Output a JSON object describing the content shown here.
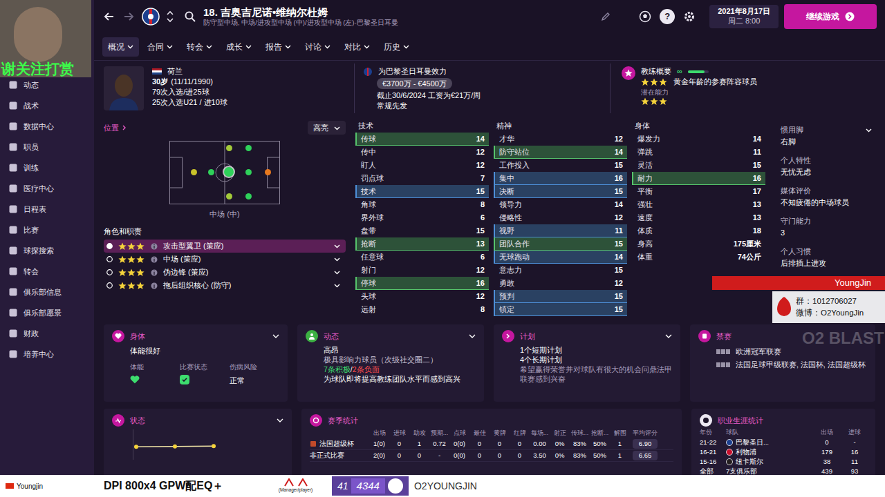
{
  "overlay": {
    "webcam_caption": "谢关注打赏",
    "banner_name": "YoungJin",
    "group": "群：1012706027",
    "weibo": "微博：O2YoungJin",
    "logo": "O2 BLAST",
    "bottom_name": "Youngjin",
    "bottom_text": "DPI 800x4 GPW配EQ＋",
    "sponsor": "(Manager/player)",
    "badge_num1": "41",
    "badge_num2": "4344",
    "channel": "O2YOUNGJIN"
  },
  "header": {
    "title": "18. 吉奥吉尼诺•维纳尔杜姆",
    "subtitle": "防守型中场, 中场/进攻型中场 (中)/进攻型中场 (左)-巴黎圣日耳曼",
    "help": "?",
    "date": "2021年8月17日",
    "time": "周二 8:00",
    "continue": "继续游戏"
  },
  "menu": [
    {
      "label": "概况",
      "selected": true
    },
    {
      "label": "合同",
      "selected": false
    },
    {
      "label": "转会",
      "selected": false
    },
    {
      "label": "成长",
      "selected": false
    },
    {
      "label": "报告",
      "selected": false
    },
    {
      "label": "讨论",
      "selected": false
    },
    {
      "label": "对比",
      "selected": false
    },
    {
      "label": "历史",
      "selected": false
    }
  ],
  "sidebar": [
    {
      "label": "动态"
    },
    {
      "label": "战术"
    },
    {
      "label": "数据中心"
    },
    {
      "label": "职员"
    },
    {
      "label": "训练"
    },
    {
      "label": "医疗中心"
    },
    {
      "label": "日程表"
    },
    {
      "label": "比赛"
    },
    {
      "label": "球探搜索"
    },
    {
      "label": "转会"
    },
    {
      "label": "俱乐部信息"
    },
    {
      "label": "俱乐部愿景"
    },
    {
      "label": "财政"
    },
    {
      "label": "培养中心"
    }
  ],
  "player": {
    "nationality": "荷兰",
    "age": "30岁",
    "birth": "(11/11/1990)",
    "caps": "79次入选/进25球",
    "u21_caps": "25次入选U21 / 进10球"
  },
  "club": {
    "plays_for": "为巴黎圣日耳曼效力",
    "value": "€3700万 - €4500万",
    "contract": "截止30/6/2024 工资为€21万/周",
    "status": "常规先发"
  },
  "coach": {
    "title": "教练概要",
    "infinity": "∞",
    "level": 0.8,
    "stars": 3,
    "summary": "黄金年龄的参赛阵容球员",
    "potential_label": "潜在能力",
    "potential_stars": 3
  },
  "position": {
    "title": "位置",
    "dropdown": "高亮",
    "label": "中场 (中)",
    "roles_title": "角色和职责",
    "dots": [
      {
        "color": "#a3c93a",
        "selected": false
      },
      {
        "color": "#2fd15a",
        "selected": false
      },
      {
        "color": "#c9c22a",
        "selected": false
      },
      {
        "color": "#2fd15a",
        "selected": false
      },
      {
        "color": "#2fd15a",
        "selected": true
      },
      {
        "color": "#2fd15a",
        "selected": false
      },
      {
        "color": "#e8781e",
        "selected": false
      },
      {
        "color": "#a3c93a",
        "selected": false
      },
      {
        "color": "#2fd15a",
        "selected": false
      }
    ],
    "roles": [
      {
        "name": "攻击型翼卫 (策应)",
        "stars": 3,
        "selected": true
      },
      {
        "name": "中场 (策应)",
        "stars": 3,
        "selected": false
      },
      {
        "name": "伪边锋 (策应)",
        "stars": 3,
        "selected": false
      },
      {
        "name": "拖后组织核心 (防守)",
        "stars": 3,
        "selected": false
      }
    ]
  },
  "attributes": [
    {
      "title": "技术",
      "rows": [
        {
          "name": "传球",
          "value": "14",
          "highlight": "green"
        },
        {
          "name": "传中",
          "value": "12",
          "highlight": "none"
        },
        {
          "name": "盯人",
          "value": "12",
          "highlight": "none"
        },
        {
          "name": "罚点球",
          "value": "7",
          "highlight": "none"
        },
        {
          "name": "技术",
          "value": "15",
          "highlight": "blue"
        },
        {
          "name": "角球",
          "value": "8",
          "highlight": "none"
        },
        {
          "name": "界外球",
          "value": "6",
          "highlight": "none"
        },
        {
          "name": "盘带",
          "value": "15",
          "highlight": "none"
        },
        {
          "name": "抢断",
          "value": "13",
          "highlight": "green"
        },
        {
          "name": "任意球",
          "value": "6",
          "highlight": "none"
        },
        {
          "name": "射门",
          "value": "12",
          "highlight": "none"
        },
        {
          "name": "停球",
          "value": "16",
          "highlight": "green"
        },
        {
          "name": "头球",
          "value": "12",
          "highlight": "none"
        },
        {
          "name": "远射",
          "value": "8",
          "highlight": "none"
        }
      ]
    },
    {
      "title": "精神",
      "rows": [
        {
          "name": "才华",
          "value": "12",
          "highlight": "none"
        },
        {
          "name": "防守站位",
          "value": "14",
          "highlight": "green"
        },
        {
          "name": "工作投入",
          "value": "15",
          "highlight": "none"
        },
        {
          "name": "集中",
          "value": "16",
          "highlight": "blue"
        },
        {
          "name": "决断",
          "value": "15",
          "highlight": "blue"
        },
        {
          "name": "领导力",
          "value": "14",
          "highlight": "none"
        },
        {
          "name": "侵略性",
          "value": "12",
          "highlight": "none"
        },
        {
          "name": "视野",
          "value": "11",
          "highlight": "blue"
        },
        {
          "name": "团队合作",
          "value": "15",
          "highlight": "green"
        },
        {
          "name": "无球跑动",
          "value": "14",
          "highlight": "blue"
        },
        {
          "name": "意志力",
          "value": "15",
          "highlight": "none"
        },
        {
          "name": "勇敢",
          "value": "12",
          "highlight": "none"
        },
        {
          "name": "预判",
          "value": "15",
          "highlight": "blue"
        },
        {
          "name": "镇定",
          "value": "15",
          "highlight": "blue"
        }
      ]
    },
    {
      "title": "身体",
      "rows": [
        {
          "name": "爆发力",
          "value": "14",
          "highlight": "none"
        },
        {
          "name": "弹跳",
          "value": "11",
          "highlight": "none"
        },
        {
          "name": "灵活",
          "value": "15",
          "highlight": "none"
        },
        {
          "name": "耐力",
          "value": "16",
          "highlight": "green"
        },
        {
          "name": "平衡",
          "value": "17",
          "highlight": "none"
        },
        {
          "name": "强壮",
          "value": "13",
          "highlight": "none"
        },
        {
          "name": "速度",
          "value": "13",
          "highlight": "none"
        },
        {
          "name": "体质",
          "value": "18",
          "highlight": "none"
        },
        {
          "name": "身高",
          "value": "175厘米",
          "highlight": "none"
        },
        {
          "name": "体重",
          "value": "74公斤",
          "highlight": "none"
        }
      ]
    }
  ],
  "details": [
    {
      "label": "惯用脚",
      "value": "右脚"
    },
    {
      "label": "个人特性",
      "value": "无忧无虑"
    },
    {
      "label": "媒体评价",
      "value": "不知疲倦的中场球员"
    },
    {
      "label": "守门能力",
      "value": "3"
    },
    {
      "label": "个人习惯",
      "value": "后排插上进攻"
    }
  ],
  "condition": {
    "title": "身体",
    "status": "体能很好",
    "fitness_label": "体能",
    "match_label": "比赛状态",
    "injury_label": "伤病风险",
    "injury": "正常"
  },
  "dynamics": {
    "title": "动态",
    "morale": "高昂",
    "influence": "极具影响力球员（次级社交圈二）",
    "positive": "7条积极",
    "separator": " / ",
    "negative": "2条负面",
    "note": "为球队即将提高教练团队水平而感到高兴"
  },
  "plans": {
    "title": "计划",
    "short": "1个短期计划",
    "long": "4个长期计划",
    "note": "希望赢得荣誉并对球队有很大的机会问鼎法甲联赛感到兴奋"
  },
  "bans": {
    "title": "禁赛",
    "items": [
      "欧洲冠军联赛",
      "法国足球甲级联赛, 法国杯, 法国超级杯"
    ]
  },
  "form": {
    "title": "状态",
    "values": [
      6.85,
      6.88,
      6.9
    ]
  },
  "season_stats": {
    "title": "赛季统计",
    "columns": [
      "出场",
      "进球",
      "助攻",
      "预期...",
      "点球",
      "最佳",
      "黄牌",
      "红牌",
      "每场...",
      "射正",
      "传球...",
      "抢断...",
      "解围",
      "平均评分"
    ],
    "rows": [
      {
        "competition": "法国超级杯",
        "cells": [
          "1(0)",
          "0",
          "1",
          "0.72",
          "0(0)",
          "0",
          "0",
          "0",
          "0.00",
          "0%",
          "83%",
          "50%",
          "1",
          "6.90"
        ]
      },
      {
        "competition": "非正式比赛",
        "cells": [
          "2(0)",
          "0",
          "0",
          "-",
          "0(0)",
          "0",
          "0",
          "0",
          "3.50",
          "0%",
          "83%",
          "50%",
          "1",
          "6.65"
        ]
      }
    ]
  },
  "career": {
    "title": "职业生涯统计",
    "columns": [
      "年份",
      "球队",
      "出场",
      "进球"
    ],
    "rows": [
      [
        "21-22",
        "巴黎圣日...",
        "0",
        "-"
      ],
      [
        "16-21",
        "利物浦",
        "179",
        "16"
      ],
      [
        "15-16",
        "纽卡斯尔",
        "38",
        "11"
      ],
      [
        "全部",
        "7支俱乐部",
        "439",
        "93"
      ]
    ]
  }
}
